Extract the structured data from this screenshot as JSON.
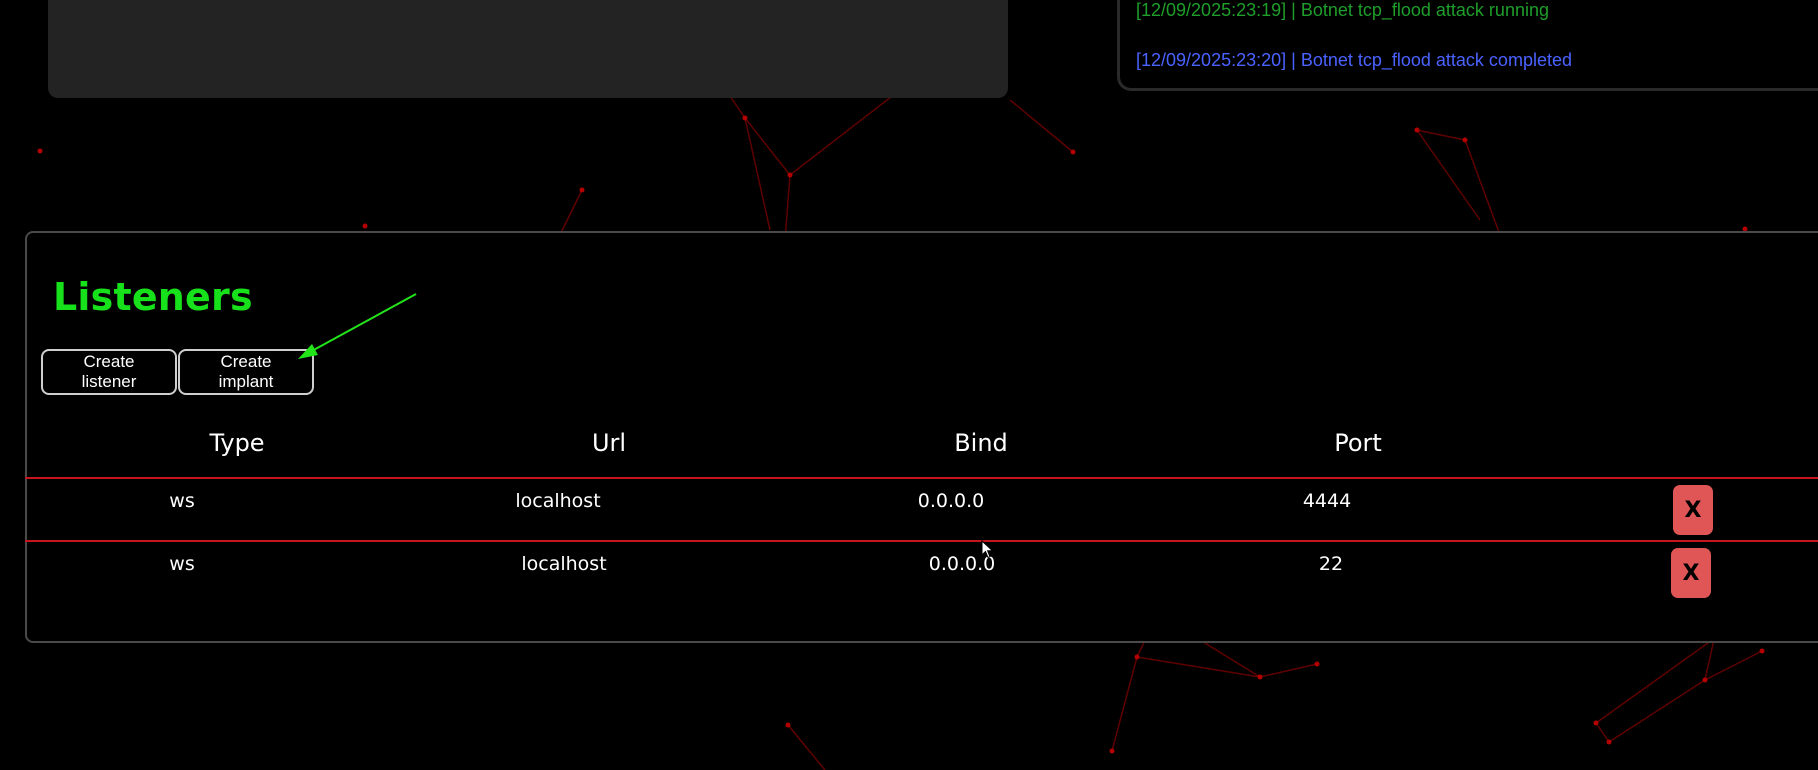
{
  "log": {
    "entries": [
      {
        "text": "[12/09/2025:23:19] | Botnet tcp_flood attack running",
        "color": "#1e9e2a"
      },
      {
        "text": "[12/09/2025:23:20] | Botnet tcp_flood attack completed",
        "color": "#4a62ff"
      }
    ]
  },
  "listeners": {
    "title": "Listeners",
    "title_color": "#17e11a",
    "buttons": {
      "create_listener": "Create listener",
      "create_implant": "Create implant"
    },
    "columns": [
      "Type",
      "Url",
      "Bind",
      "Port"
    ],
    "rows": [
      {
        "type": "ws",
        "url": "localhost",
        "bind": "0.0.0.0",
        "port": "4444",
        "delete": "X"
      },
      {
        "type": "ws",
        "url": "localhost",
        "bind": "0.0.0.0",
        "port": "22",
        "delete": "X"
      }
    ]
  },
  "colors": {
    "background": "#000000",
    "accent_red": "#c4161c",
    "delete_button": "#e05555",
    "annotation_arrow": "#22e51a"
  }
}
